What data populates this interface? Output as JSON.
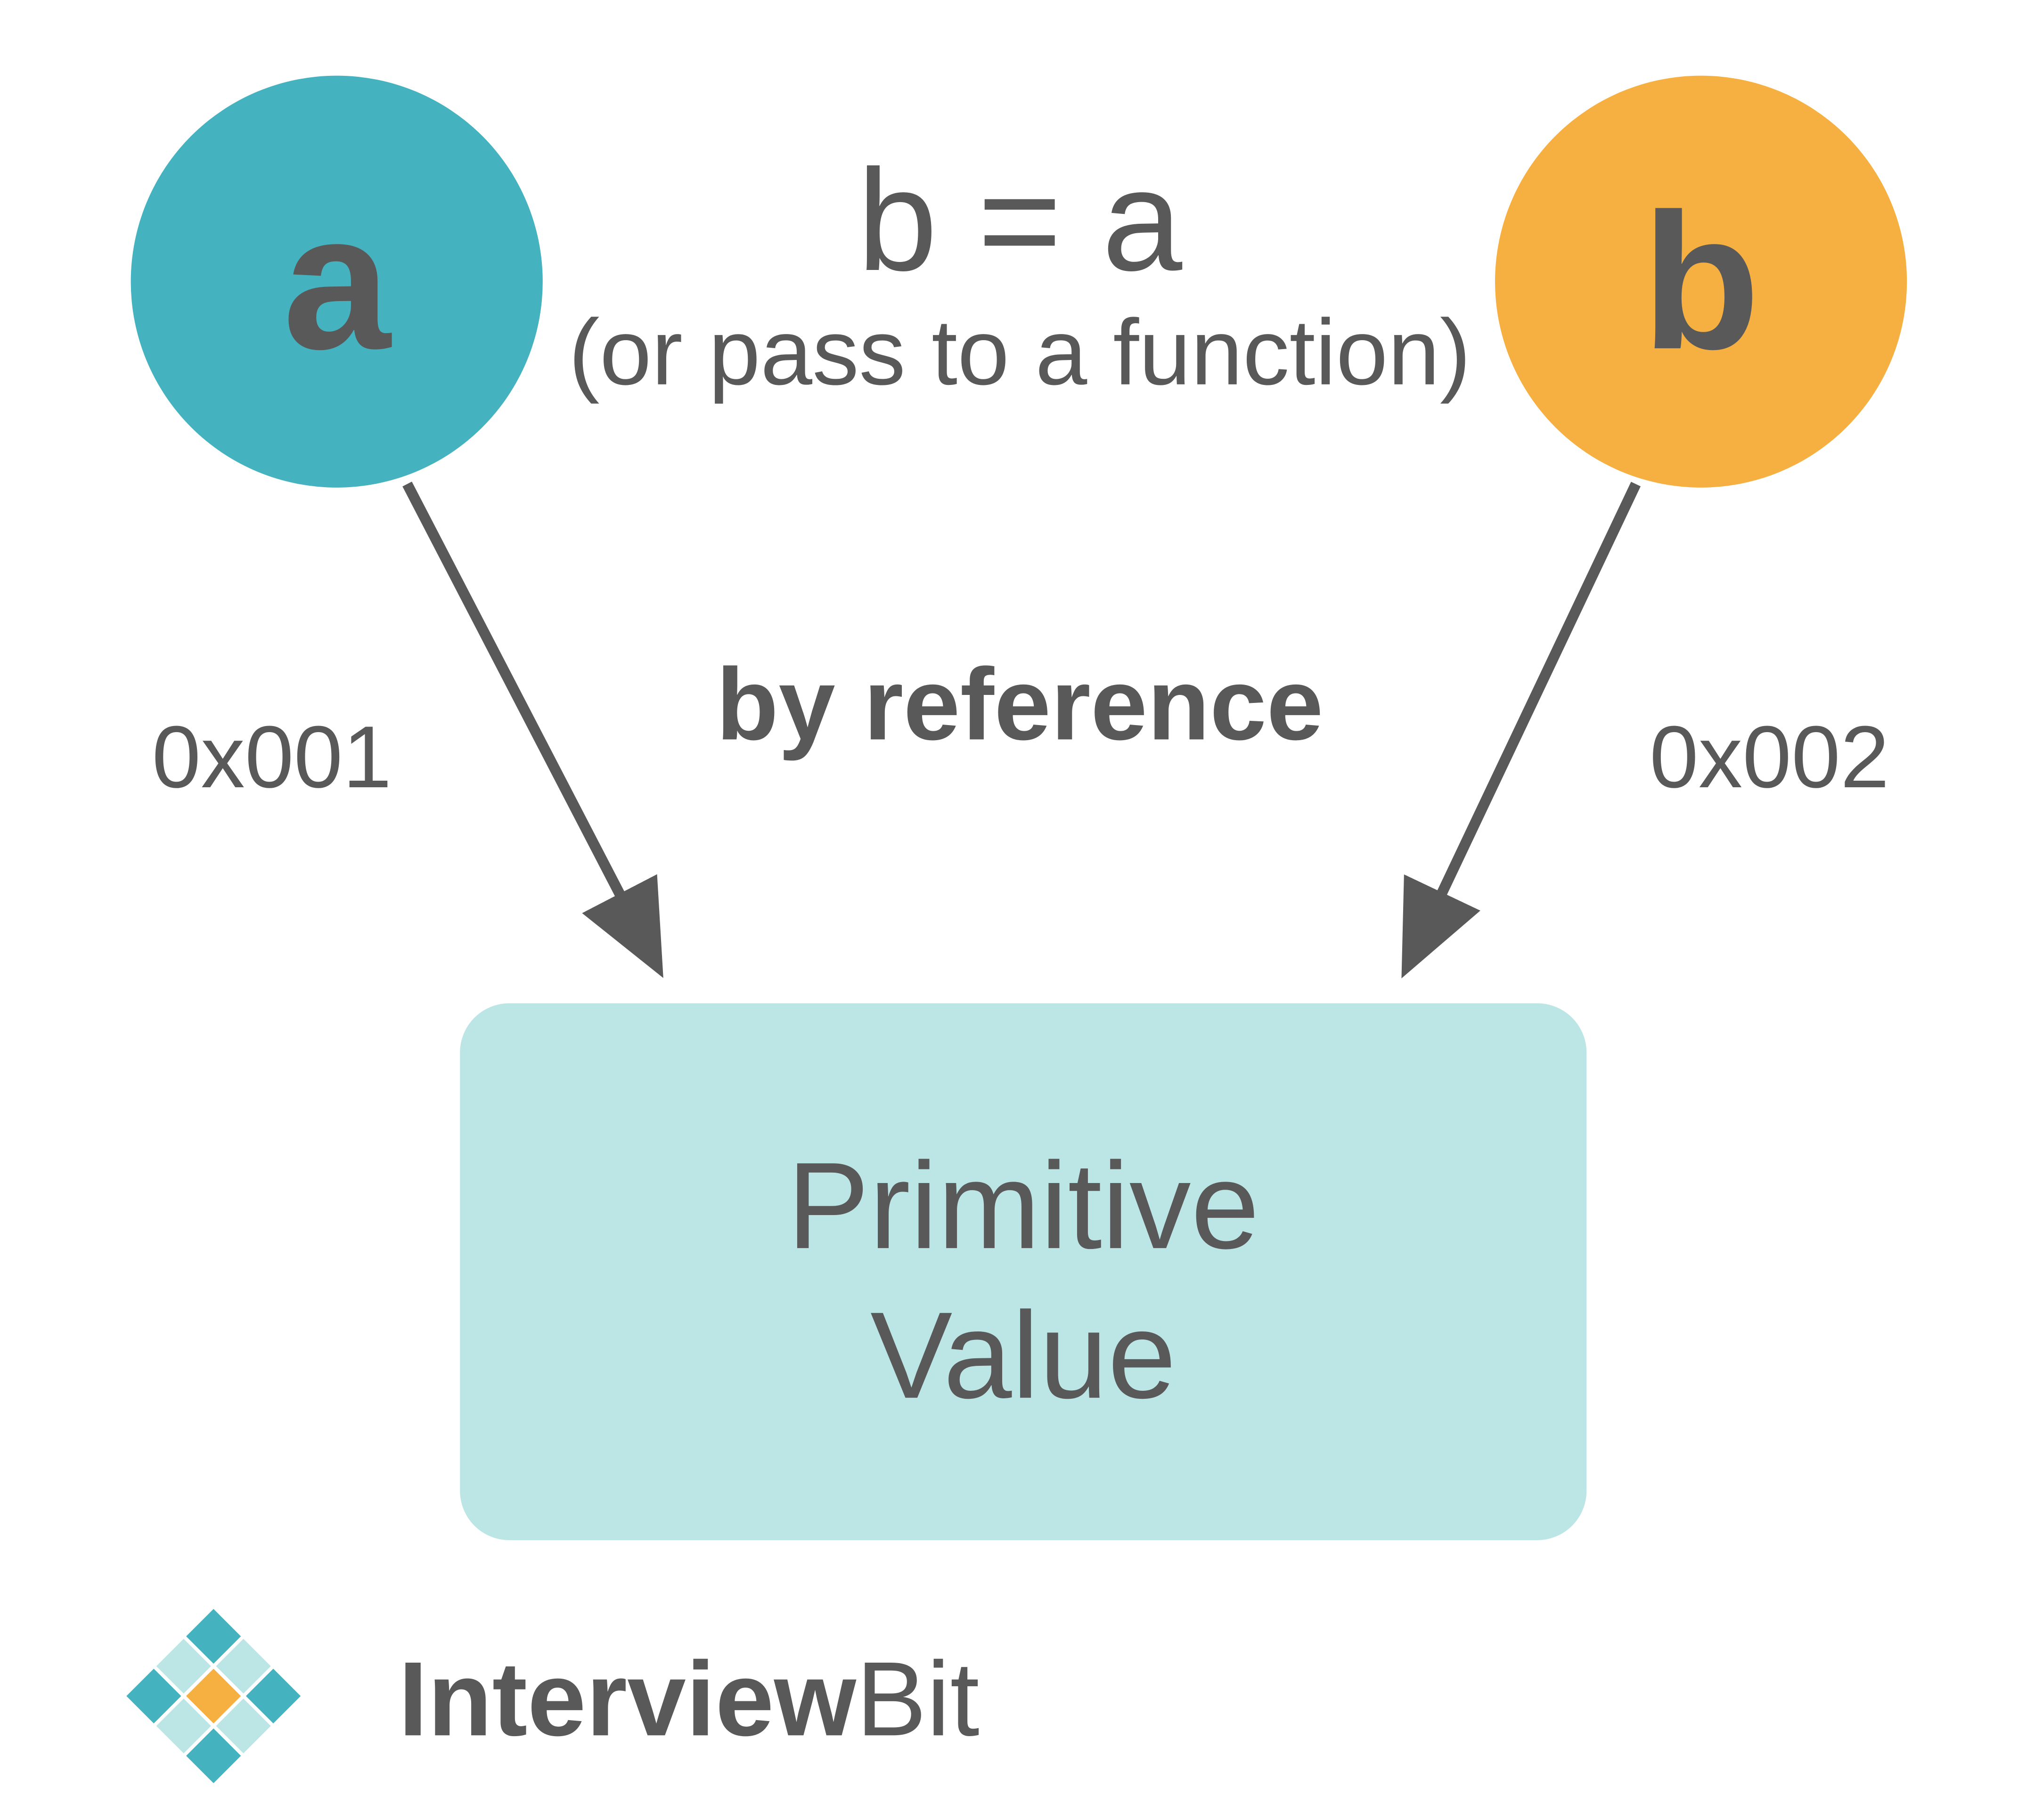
{
  "nodes": {
    "a": {
      "label": "a",
      "color": "#45b2bf",
      "address": "0x001"
    },
    "b": {
      "label": "b",
      "color": "#f6b042",
      "address": "0x002"
    }
  },
  "equation": {
    "main": "b = a",
    "sub": "(or pass to a function)"
  },
  "method": "by reference",
  "target": {
    "line1": "Primitive",
    "line2": "Value",
    "color": "#bce5e5"
  },
  "brand": {
    "name_prefix": "Interview",
    "name_suffix": "Bit",
    "colors": {
      "teal": "#45b2bf",
      "orange": "#f6b042",
      "light": "#bce5e5"
    }
  },
  "colors": {
    "text": "#595959",
    "arrow": "#595959"
  }
}
